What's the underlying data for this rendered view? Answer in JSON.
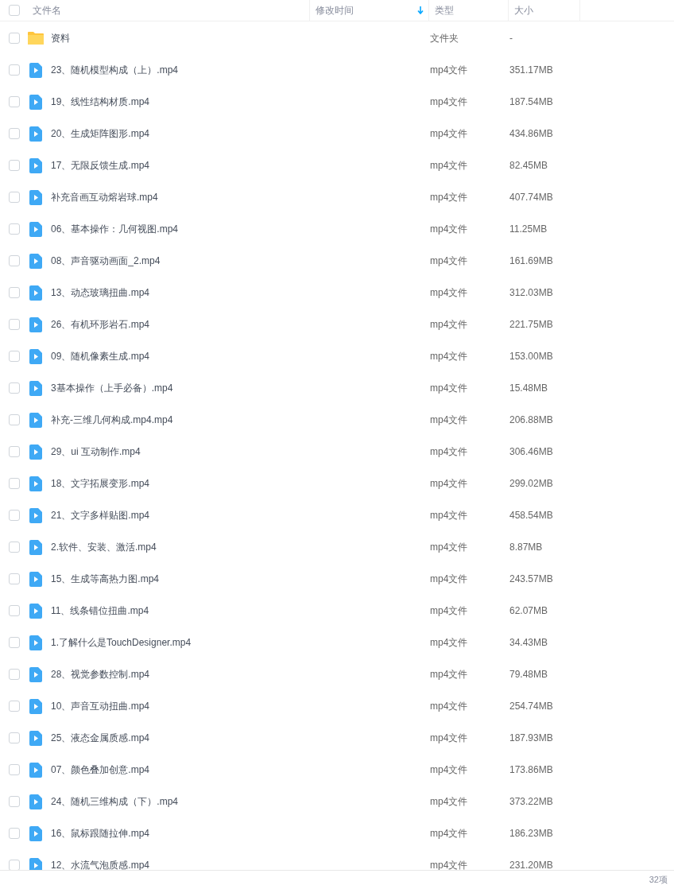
{
  "header": {
    "columns": [
      {
        "label": "文件名",
        "sorted": false
      },
      {
        "label": "修改时间",
        "sorted": true
      },
      {
        "label": "类型",
        "sorted": false
      },
      {
        "label": "大小",
        "sorted": false
      }
    ],
    "checked": false
  },
  "rows": [
    {
      "kind": "folder",
      "name": "资料",
      "type": "文件夹",
      "size": "-",
      "checked": false
    },
    {
      "kind": "video",
      "name": "23、随机模型构成（上）.mp4",
      "type": "mp4文件",
      "size": "351.17MB",
      "checked": false
    },
    {
      "kind": "video",
      "name": "19、线性结构材质.mp4",
      "type": "mp4文件",
      "size": "187.54MB",
      "checked": false
    },
    {
      "kind": "video",
      "name": "20、生成矩阵图形.mp4",
      "type": "mp4文件",
      "size": "434.86MB",
      "checked": false
    },
    {
      "kind": "video",
      "name": "17、无限反馈生成.mp4",
      "type": "mp4文件",
      "size": "82.45MB",
      "checked": false
    },
    {
      "kind": "video",
      "name": "补充音画互动熔岩球.mp4",
      "type": "mp4文件",
      "size": "407.74MB",
      "checked": false
    },
    {
      "kind": "video",
      "name": "06、基本操作：几何视图.mp4",
      "type": "mp4文件",
      "size": "11.25MB",
      "checked": false
    },
    {
      "kind": "video",
      "name": "08、声音驱动画面_2.mp4",
      "type": "mp4文件",
      "size": "161.69MB",
      "checked": false
    },
    {
      "kind": "video",
      "name": "13、动态玻璃扭曲.mp4",
      "type": "mp4文件",
      "size": "312.03MB",
      "checked": false
    },
    {
      "kind": "video",
      "name": "26、有机环形岩石.mp4",
      "type": "mp4文件",
      "size": "221.75MB",
      "checked": false
    },
    {
      "kind": "video",
      "name": "09、随机像素生成.mp4",
      "type": "mp4文件",
      "size": "153.00MB",
      "checked": false
    },
    {
      "kind": "video",
      "name": "3基本操作（上手必备）.mp4",
      "type": "mp4文件",
      "size": "15.48MB",
      "checked": false
    },
    {
      "kind": "video",
      "name": "补充-三维几何构成.mp4.mp4",
      "type": "mp4文件",
      "size": "206.88MB",
      "checked": false
    },
    {
      "kind": "video",
      "name": "29、ui 互动制作.mp4",
      "type": "mp4文件",
      "size": "306.46MB",
      "checked": false
    },
    {
      "kind": "video",
      "name": "18、文字拓展变形.mp4",
      "type": "mp4文件",
      "size": "299.02MB",
      "checked": false
    },
    {
      "kind": "video",
      "name": "21、文字多样贴图.mp4",
      "type": "mp4文件",
      "size": "458.54MB",
      "checked": false
    },
    {
      "kind": "video",
      "name": "2.软件、安装、激活.mp4",
      "type": "mp4文件",
      "size": "8.87MB",
      "checked": false
    },
    {
      "kind": "video",
      "name": "15、生成等高热力图.mp4",
      "type": "mp4文件",
      "size": "243.57MB",
      "checked": false
    },
    {
      "kind": "video",
      "name": "11、线条错位扭曲.mp4",
      "type": "mp4文件",
      "size": "62.07MB",
      "checked": false
    },
    {
      "kind": "video",
      "name": "1.了解什么是TouchDesigner.mp4",
      "type": "mp4文件",
      "size": "34.43MB",
      "checked": false
    },
    {
      "kind": "video",
      "name": "28、视觉参数控制.mp4",
      "type": "mp4文件",
      "size": "79.48MB",
      "checked": false
    },
    {
      "kind": "video",
      "name": "10、声音互动扭曲.mp4",
      "type": "mp4文件",
      "size": "254.74MB",
      "checked": false
    },
    {
      "kind": "video",
      "name": "25、液态金属质感.mp4",
      "type": "mp4文件",
      "size": "187.93MB",
      "checked": false
    },
    {
      "kind": "video",
      "name": "07、颜色叠加创意.mp4",
      "type": "mp4文件",
      "size": "173.86MB",
      "checked": false
    },
    {
      "kind": "video",
      "name": "24、随机三维构成（下）.mp4",
      "type": "mp4文件",
      "size": "373.22MB",
      "checked": false
    },
    {
      "kind": "video",
      "name": "16、鼠标跟随拉伸.mp4",
      "type": "mp4文件",
      "size": "186.23MB",
      "checked": false
    },
    {
      "kind": "video",
      "name": "12、水流气泡质感.mp4",
      "type": "mp4文件",
      "size": "231.20MB",
      "checked": false
    }
  ],
  "footer": {
    "count": "32项"
  }
}
